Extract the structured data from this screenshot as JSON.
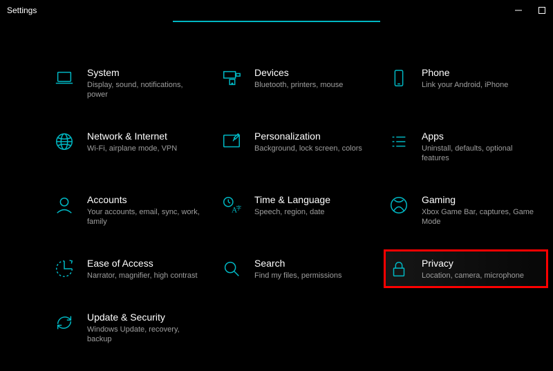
{
  "window": {
    "title": "Settings"
  },
  "accent": "#00b7c3",
  "items": [
    {
      "id": "system",
      "icon": "laptop-icon",
      "title": "System",
      "desc": "Display, sound, notifications, power"
    },
    {
      "id": "devices",
      "icon": "devices-icon",
      "title": "Devices",
      "desc": "Bluetooth, printers, mouse"
    },
    {
      "id": "phone",
      "icon": "phone-icon",
      "title": "Phone",
      "desc": "Link your Android, iPhone"
    },
    {
      "id": "network",
      "icon": "globe-icon",
      "title": "Network & Internet",
      "desc": "Wi-Fi, airplane mode, VPN"
    },
    {
      "id": "personalization",
      "icon": "brush-icon",
      "title": "Personalization",
      "desc": "Background, lock screen, colors"
    },
    {
      "id": "apps",
      "icon": "list-icon",
      "title": "Apps",
      "desc": "Uninstall, defaults, optional features"
    },
    {
      "id": "accounts",
      "icon": "person-icon",
      "title": "Accounts",
      "desc": "Your accounts, email, sync, work, family"
    },
    {
      "id": "time",
      "icon": "time-lang-icon",
      "title": "Time & Language",
      "desc": "Speech, region, date"
    },
    {
      "id": "gaming",
      "icon": "xbox-icon",
      "title": "Gaming",
      "desc": "Xbox Game Bar, captures, Game Mode"
    },
    {
      "id": "ease",
      "icon": "ease-icon",
      "title": "Ease of Access",
      "desc": "Narrator, magnifier, high contrast"
    },
    {
      "id": "search",
      "icon": "search-icon",
      "title": "Search",
      "desc": "Find my files, permissions"
    },
    {
      "id": "privacy",
      "icon": "lock-icon",
      "title": "Privacy",
      "desc": "Location, camera, microphone",
      "highlighted": true
    },
    {
      "id": "update",
      "icon": "sync-icon",
      "title": "Update & Security",
      "desc": "Windows Update, recovery, backup"
    }
  ]
}
